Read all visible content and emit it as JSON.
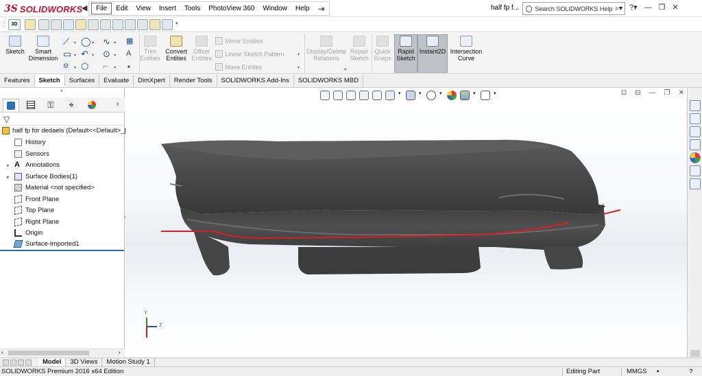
{
  "app": {
    "logo_mark": "3S",
    "logo_text": "SOLIDWORKS",
    "doc_title": "half fp f...",
    "help_search_placeholder": "Search SOLIDWORKS Help"
  },
  "menu": [
    "File",
    "Edit",
    "View",
    "Insert",
    "Tools",
    "PhotoView 360",
    "Window",
    "Help"
  ],
  "command_manager": {
    "sketch": "Sketch",
    "smart_dimension": [
      "Smart",
      "Dimension"
    ],
    "trim_entities": [
      "Trim",
      "Entities"
    ],
    "convert_entities": [
      "Convert",
      "Entities"
    ],
    "offset_entities": [
      "Offset",
      "Entities"
    ],
    "mirror_entities": "Mirror Entities",
    "linear_sketch_pattern": "Linear Sketch Pattern",
    "move_entities": "Move Entities",
    "display_delete_relations": [
      "Display/Delete",
      "Relations"
    ],
    "repair_sketch": [
      "Repair",
      "Sketch"
    ],
    "quick_snaps": [
      "Quick",
      "Snaps"
    ],
    "rapid_sketch": [
      "Rapid",
      "Sketch"
    ],
    "instant2d": "Instant2D",
    "intersection_curve": [
      "Intersection",
      "Curve"
    ]
  },
  "tabs": [
    "Features",
    "Sketch",
    "Surfaces",
    "Evaluate",
    "DimXpert",
    "Render Tools",
    "SOLIDWORKS Add-Ins",
    "SOLIDWORKS MBD"
  ],
  "active_tab": "Sketch",
  "feature_tree": {
    "root": "half fp for dedaels  (Default<<Default>_[",
    "items": [
      {
        "label": "History",
        "icon": "history-icon"
      },
      {
        "label": "Sensors",
        "icon": "sensors-icon"
      },
      {
        "label": "Annotations",
        "icon": "annotations-icon",
        "expandable": true
      },
      {
        "label": "Surface Bodies(1)",
        "icon": "surface-bodies-icon",
        "expandable": true
      },
      {
        "label": "Material <not specified>",
        "icon": "material-icon"
      },
      {
        "label": "Front Plane",
        "icon": "plane-icon"
      },
      {
        "label": "Top Plane",
        "icon": "plane-icon"
      },
      {
        "label": "Right Plane",
        "icon": "plane-icon"
      },
      {
        "label": "Origin",
        "icon": "origin-icon"
      },
      {
        "label": "Surface-Imported1",
        "icon": "surface-imported-icon"
      }
    ]
  },
  "bottom_tabs": [
    "Model",
    "3D Views",
    "Motion Study 1"
  ],
  "active_bottom_tab": "Model",
  "status": {
    "product": "SOLIDWORKS Premium 2016 x64 Edition",
    "mode": "Editing Part",
    "units": "MMGS",
    "help": "?"
  },
  "triad": {
    "y_label": "Y",
    "z_label": "Z"
  },
  "colors": {
    "brand": "#c8102e",
    "sketch_line": "#d62020",
    "model": "#4a4a4a"
  }
}
